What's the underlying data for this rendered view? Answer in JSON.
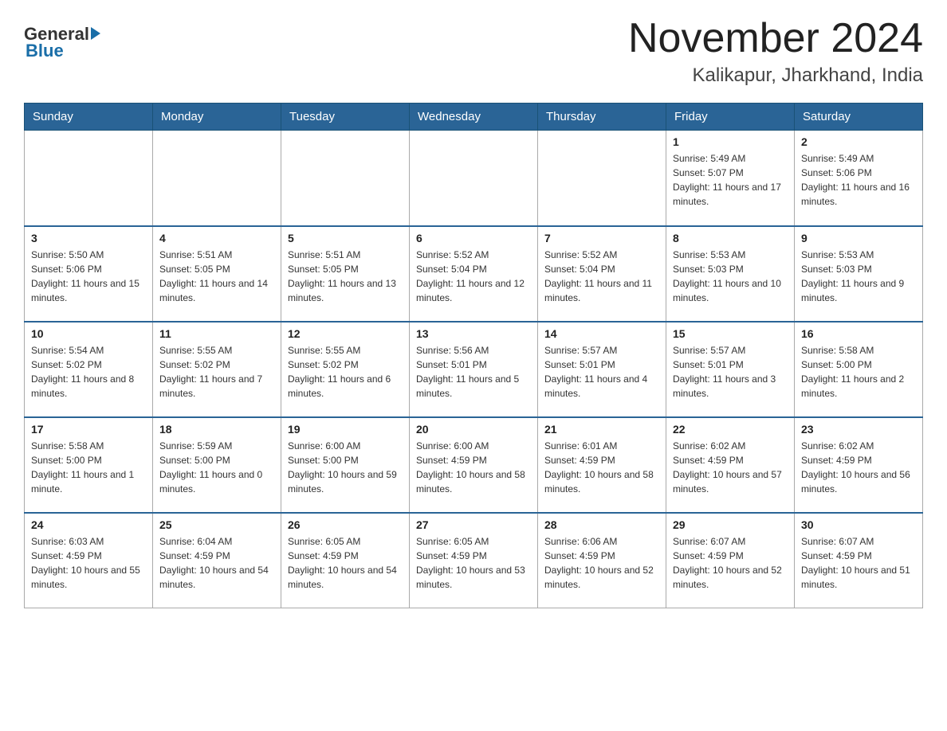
{
  "header": {
    "logo_general": "General",
    "logo_blue": "Blue",
    "month_year": "November 2024",
    "location": "Kalikapur, Jharkhand, India"
  },
  "weekdays": [
    "Sunday",
    "Monday",
    "Tuesday",
    "Wednesday",
    "Thursday",
    "Friday",
    "Saturday"
  ],
  "weeks": [
    [
      {
        "day": "",
        "info": ""
      },
      {
        "day": "",
        "info": ""
      },
      {
        "day": "",
        "info": ""
      },
      {
        "day": "",
        "info": ""
      },
      {
        "day": "",
        "info": ""
      },
      {
        "day": "1",
        "info": "Sunrise: 5:49 AM\nSunset: 5:07 PM\nDaylight: 11 hours and 17 minutes."
      },
      {
        "day": "2",
        "info": "Sunrise: 5:49 AM\nSunset: 5:06 PM\nDaylight: 11 hours and 16 minutes."
      }
    ],
    [
      {
        "day": "3",
        "info": "Sunrise: 5:50 AM\nSunset: 5:06 PM\nDaylight: 11 hours and 15 minutes."
      },
      {
        "day": "4",
        "info": "Sunrise: 5:51 AM\nSunset: 5:05 PM\nDaylight: 11 hours and 14 minutes."
      },
      {
        "day": "5",
        "info": "Sunrise: 5:51 AM\nSunset: 5:05 PM\nDaylight: 11 hours and 13 minutes."
      },
      {
        "day": "6",
        "info": "Sunrise: 5:52 AM\nSunset: 5:04 PM\nDaylight: 11 hours and 12 minutes."
      },
      {
        "day": "7",
        "info": "Sunrise: 5:52 AM\nSunset: 5:04 PM\nDaylight: 11 hours and 11 minutes."
      },
      {
        "day": "8",
        "info": "Sunrise: 5:53 AM\nSunset: 5:03 PM\nDaylight: 11 hours and 10 minutes."
      },
      {
        "day": "9",
        "info": "Sunrise: 5:53 AM\nSunset: 5:03 PM\nDaylight: 11 hours and 9 minutes."
      }
    ],
    [
      {
        "day": "10",
        "info": "Sunrise: 5:54 AM\nSunset: 5:02 PM\nDaylight: 11 hours and 8 minutes."
      },
      {
        "day": "11",
        "info": "Sunrise: 5:55 AM\nSunset: 5:02 PM\nDaylight: 11 hours and 7 minutes."
      },
      {
        "day": "12",
        "info": "Sunrise: 5:55 AM\nSunset: 5:02 PM\nDaylight: 11 hours and 6 minutes."
      },
      {
        "day": "13",
        "info": "Sunrise: 5:56 AM\nSunset: 5:01 PM\nDaylight: 11 hours and 5 minutes."
      },
      {
        "day": "14",
        "info": "Sunrise: 5:57 AM\nSunset: 5:01 PM\nDaylight: 11 hours and 4 minutes."
      },
      {
        "day": "15",
        "info": "Sunrise: 5:57 AM\nSunset: 5:01 PM\nDaylight: 11 hours and 3 minutes."
      },
      {
        "day": "16",
        "info": "Sunrise: 5:58 AM\nSunset: 5:00 PM\nDaylight: 11 hours and 2 minutes."
      }
    ],
    [
      {
        "day": "17",
        "info": "Sunrise: 5:58 AM\nSunset: 5:00 PM\nDaylight: 11 hours and 1 minute."
      },
      {
        "day": "18",
        "info": "Sunrise: 5:59 AM\nSunset: 5:00 PM\nDaylight: 11 hours and 0 minutes."
      },
      {
        "day": "19",
        "info": "Sunrise: 6:00 AM\nSunset: 5:00 PM\nDaylight: 10 hours and 59 minutes."
      },
      {
        "day": "20",
        "info": "Sunrise: 6:00 AM\nSunset: 4:59 PM\nDaylight: 10 hours and 58 minutes."
      },
      {
        "day": "21",
        "info": "Sunrise: 6:01 AM\nSunset: 4:59 PM\nDaylight: 10 hours and 58 minutes."
      },
      {
        "day": "22",
        "info": "Sunrise: 6:02 AM\nSunset: 4:59 PM\nDaylight: 10 hours and 57 minutes."
      },
      {
        "day": "23",
        "info": "Sunrise: 6:02 AM\nSunset: 4:59 PM\nDaylight: 10 hours and 56 minutes."
      }
    ],
    [
      {
        "day": "24",
        "info": "Sunrise: 6:03 AM\nSunset: 4:59 PM\nDaylight: 10 hours and 55 minutes."
      },
      {
        "day": "25",
        "info": "Sunrise: 6:04 AM\nSunset: 4:59 PM\nDaylight: 10 hours and 54 minutes."
      },
      {
        "day": "26",
        "info": "Sunrise: 6:05 AM\nSunset: 4:59 PM\nDaylight: 10 hours and 54 minutes."
      },
      {
        "day": "27",
        "info": "Sunrise: 6:05 AM\nSunset: 4:59 PM\nDaylight: 10 hours and 53 minutes."
      },
      {
        "day": "28",
        "info": "Sunrise: 6:06 AM\nSunset: 4:59 PM\nDaylight: 10 hours and 52 minutes."
      },
      {
        "day": "29",
        "info": "Sunrise: 6:07 AM\nSunset: 4:59 PM\nDaylight: 10 hours and 52 minutes."
      },
      {
        "day": "30",
        "info": "Sunrise: 6:07 AM\nSunset: 4:59 PM\nDaylight: 10 hours and 51 minutes."
      }
    ]
  ]
}
